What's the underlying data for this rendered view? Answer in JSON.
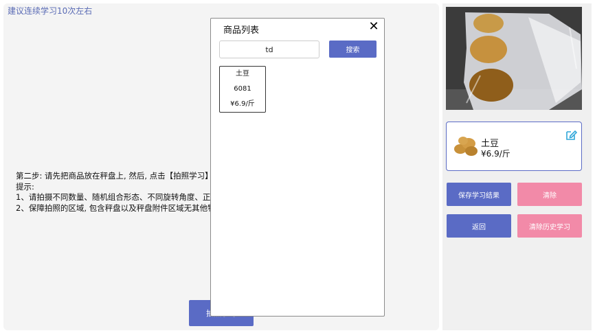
{
  "left": {
    "hint": "建议连续学习10次左右",
    "instructions": [
      "第二步: 请先把商品放在秤盘上, 然后, 点击【拍照学习】",
      "提示:",
      "1、请拍摄不同数量、随机组合形态、不同旋转角度、正",
      "2、保障拍照的区域, 包含秤盘以及秤盘附件区域无其他物"
    ],
    "photo_learn_label": "拍照学习"
  },
  "modal": {
    "title": "商品列表",
    "search_value": "td",
    "search_label": "搜索",
    "results": [
      {
        "name": "土豆",
        "code": "6081",
        "price": "¥6.9/斤"
      }
    ]
  },
  "right": {
    "product": {
      "name": "土豆",
      "price": "¥6.9/斤"
    },
    "buttons": {
      "save": "保存学习结果",
      "clear": "清除",
      "back": "返回",
      "clear_history": "清除历史学习"
    }
  },
  "colors": {
    "accent_blue": "#5a6bc5",
    "accent_pink": "#f28aa8",
    "hint_text": "#5a6bb5"
  }
}
